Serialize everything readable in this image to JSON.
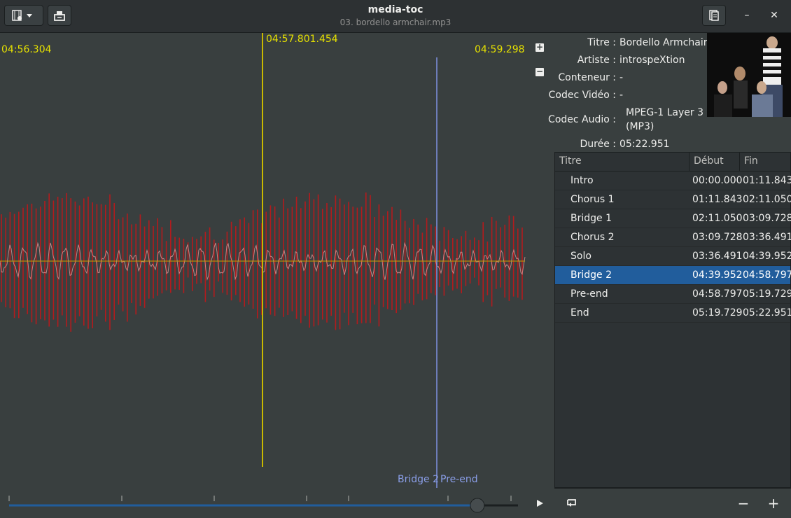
{
  "window": {
    "title": "media-toc",
    "subtitle": "03. bordello armchair.mp3"
  },
  "header": {
    "open_menu_icon": "media-menu-icon",
    "export_icon": "export-icon",
    "info_toggle_icon": "info-toggle-icon",
    "minimize_label": "–",
    "close_label": "✕"
  },
  "waveform": {
    "start_time": "04:56.304",
    "cursor_time": "04:57.801.454",
    "end_time": "04:59.298",
    "zoom_in_label": "+",
    "zoom_out_label": "−",
    "chapter_left_label": "Bridge 2",
    "chapter_right_label": "Pre-end",
    "cursor_color": "#c8b800",
    "chapter_marker_color": "#7f90e0",
    "waveform_color": "#c0181a",
    "waveform_highlight_color": "#e5a0a0"
  },
  "info": {
    "labels": {
      "title": "Titre :",
      "artist": "Artiste :",
      "container": "Conteneur :",
      "video_codec": "Codec Vidéo :",
      "audio_codec": "Codec Audio :",
      "duration": "Durée :"
    },
    "values": {
      "title": "Bordello Armchair",
      "artist": "introspeXtion",
      "container": "-",
      "video_codec": "-",
      "audio_codec_line1": "MPEG-1 Layer 3",
      "audio_codec_line2": "(MP3)",
      "duration": "05:22.951"
    }
  },
  "chapters": {
    "headers": [
      "Titre",
      "Début",
      "Fin"
    ],
    "rows": [
      {
        "title": "Intro",
        "start": "00:00.000",
        "end": "01:11.843"
      },
      {
        "title": "Chorus 1",
        "start": "01:11.843",
        "end": "02:11.050"
      },
      {
        "title": "Bridge 1",
        "start": "02:11.050",
        "end": "03:09.728"
      },
      {
        "title": "Chorus 2",
        "start": "03:09.728",
        "end": "03:36.491"
      },
      {
        "title": "Solo",
        "start": "03:36.491",
        "end": "04:39.952"
      },
      {
        "title": "Bridge 2",
        "start": "04:39.952",
        "end": "04:58.797"
      },
      {
        "title": "Pre-end",
        "start": "04:58.797",
        "end": "05:19.729"
      },
      {
        "title": "End",
        "start": "05:19.729",
        "end": "05:22.951"
      }
    ],
    "selected_index": 5
  },
  "controls": {
    "play_icon": "play-icon",
    "repeat_icon": "repeat-icon",
    "remove_label": "−",
    "add_label": "+",
    "seek_position": 0.92
  }
}
